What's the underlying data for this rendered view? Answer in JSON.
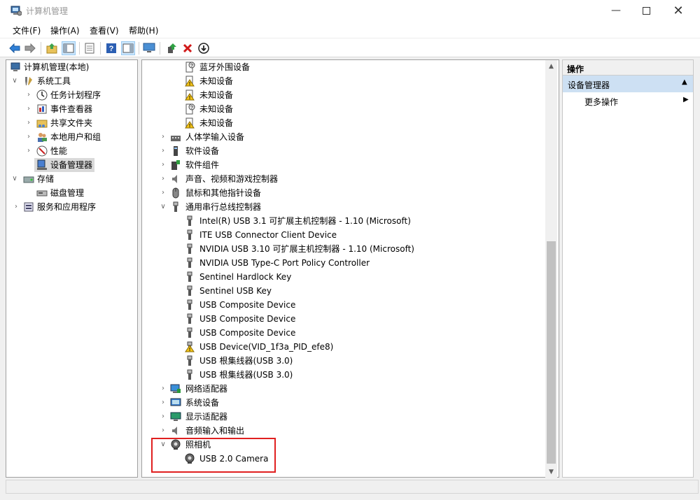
{
  "window": {
    "title": "计算机管理",
    "controls": [
      "minimize-icon",
      "maximize-icon",
      "close-icon"
    ]
  },
  "menu": {
    "file": "文件(F)",
    "action": "操作(A)",
    "view": "查看(V)",
    "help": "帮助(H)"
  },
  "toolbar": {
    "icons": [
      "back-arrow-icon",
      "forward-arrow-icon",
      "up-folder-icon",
      "show-hide-tree-icon",
      "properties-icon",
      "help-icon",
      "action-pane-icon",
      "monitor-icon",
      "update-driver-icon",
      "uninstall-icon",
      "disable-device-icon"
    ]
  },
  "left_tree": {
    "root": "计算机管理(本地)",
    "system_tools": "系统工具",
    "task_scheduler": "任务计划程序",
    "event_viewer": "事件查看器",
    "shared_folders": "共享文件夹",
    "local_users": "本地用户和组",
    "performance": "性能",
    "device_manager": "设备管理器",
    "storage": "存储",
    "disk_management": "磁盘管理",
    "services_apps": "服务和应用程序"
  },
  "devices": {
    "bt_peripheral": "蓝牙外围设备",
    "unknown1": "未知设备",
    "unknown2": "未知设备",
    "unknown3": "未知设备",
    "unknown4": "未知设备",
    "hid": "人体学输入设备",
    "software_devices": "软件设备",
    "software_components": "软件组件",
    "sound": "声音、视频和游戏控制器",
    "mice": "鼠标和其他指针设备",
    "usb_controllers": "通用串行总线控制器",
    "usb_items": [
      "Intel(R) USB 3.1 可扩展主机控制器 - 1.10 (Microsoft)",
      "ITE USB Connector Client Device",
      "NVIDIA USB 3.10 可扩展主机控制器 - 1.10 (Microsoft)",
      "NVIDIA USB Type-C Port Policy Controller",
      "Sentinel Hardlock Key",
      "Sentinel USB Key",
      "USB Composite Device",
      "USB Composite Device",
      "USB Composite Device",
      "USB Device(VID_1f3a_PID_efe8)",
      "USB 根集线器(USB 3.0)",
      "USB 根集线器(USB 3.0)"
    ],
    "network": "网络适配器",
    "system": "系统设备",
    "display": "显示适配器",
    "audio_io": "音频输入和输出",
    "camera": "照相机",
    "camera_item": "USB 2.0 Camera"
  },
  "actions": {
    "header": "操作",
    "section": "设备管理器",
    "more": "更多操作"
  }
}
